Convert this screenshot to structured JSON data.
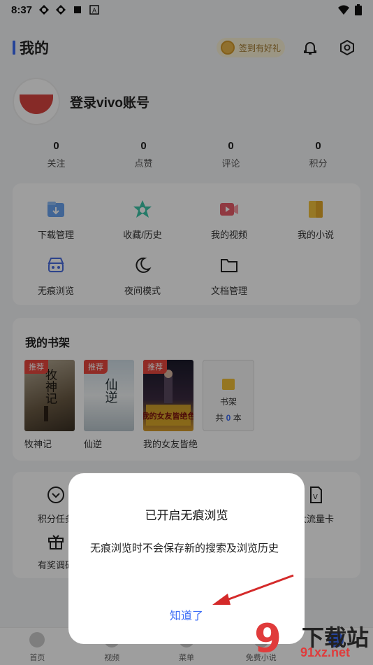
{
  "statusbar": {
    "time": "8:37"
  },
  "header": {
    "title": "我的",
    "signin_label": "签到有好礼"
  },
  "profile": {
    "login_text": "登录vivo账号"
  },
  "stats": [
    {
      "num": "0",
      "label": "关注"
    },
    {
      "num": "0",
      "label": "点赞"
    },
    {
      "num": "0",
      "label": "评论"
    },
    {
      "num": "0",
      "label": "积分"
    }
  ],
  "tools": [
    {
      "label": "下载管理",
      "icon": "download-icon"
    },
    {
      "label": "收藏/历史",
      "icon": "star-clock-icon"
    },
    {
      "label": "我的视频",
      "icon": "video-icon"
    },
    {
      "label": "我的小说",
      "icon": "book-icon"
    },
    {
      "label": "无痕浏览",
      "icon": "incognito-icon"
    },
    {
      "label": "夜间模式",
      "icon": "moon-icon"
    },
    {
      "label": "文档管理",
      "icon": "folder-icon"
    }
  ],
  "shelf": {
    "title": "我的书架",
    "books": [
      {
        "tag": "推荐",
        "name": "牧神记",
        "cover_text": "牧神记"
      },
      {
        "tag": "推荐",
        "name": "仙逆",
        "cover_text": "仙逆"
      },
      {
        "tag": "推荐",
        "name": "我的女友皆绝",
        "cover_text": "我的女友皆绝色"
      }
    ],
    "shelf_label": "书架",
    "shelf_count_prefix": "共",
    "shelf_count": "0",
    "shelf_count_suffix": "本"
  },
  "more": [
    {
      "label": "积分任务",
      "icon": "chevron-circle-icon"
    },
    {
      "label": "大流量卡",
      "icon": "sim-card-icon"
    },
    {
      "label": "有奖调研",
      "icon": "gift-icon"
    }
  ],
  "bottom_nav": [
    "首页",
    "视频",
    "菜单",
    "免费小说",
    ""
  ],
  "dialog": {
    "title": "已开启无痕浏览",
    "body": "无痕浏览时不会保存新的搜索及浏览历史",
    "button": "知道了"
  },
  "watermark": {
    "big": "9",
    "line1": "下载站",
    "line2": "91xz.net"
  },
  "colors": {
    "accent": "#3d6df6",
    "tag_red": "#e8473e"
  }
}
